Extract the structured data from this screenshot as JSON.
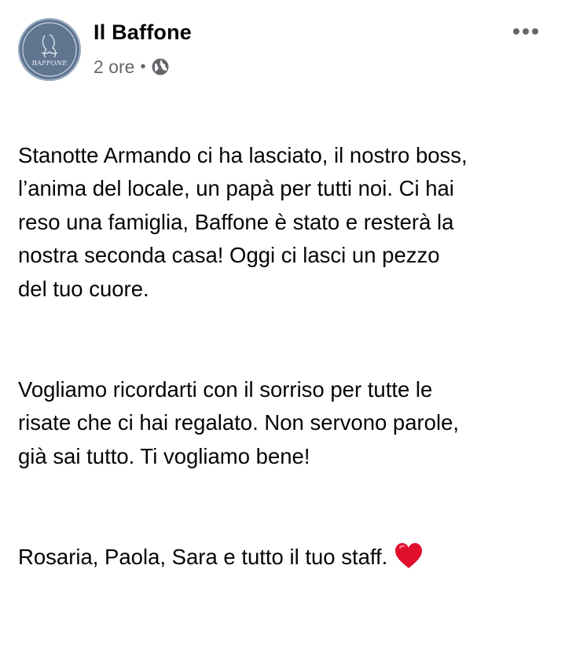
{
  "post": {
    "author": "Il Baffone",
    "avatar_text": "BAFFONE",
    "time": "2 ore",
    "separator": "•",
    "audience_icon": "globe-icon",
    "more_icon": "more-options-icon",
    "paragraphs": [
      "Stanotte Armando ci ha lasciato, il nostro boss,\nl’anima del locale, un papà per tutti noi. Ci hai\nreso una famiglia, Baffone è stato e resterà la\nnostra seconda casa! Oggi ci lasci un pezzo\ndel tuo cuore.",
      "Vogliamo ricordarti con il sorriso per tutte le\nrisate che ci hai regalato. Non servono parole,\ngià sai tutto. Ti vogliamo bene!",
      "Rosaria, Paola, Sara e tutto il tuo staff."
    ],
    "emoji": "heart-emoji",
    "colors": {
      "text": "#050505",
      "meta": "#65676b",
      "avatar": "#5f7590",
      "heart": "#e0102d"
    }
  }
}
